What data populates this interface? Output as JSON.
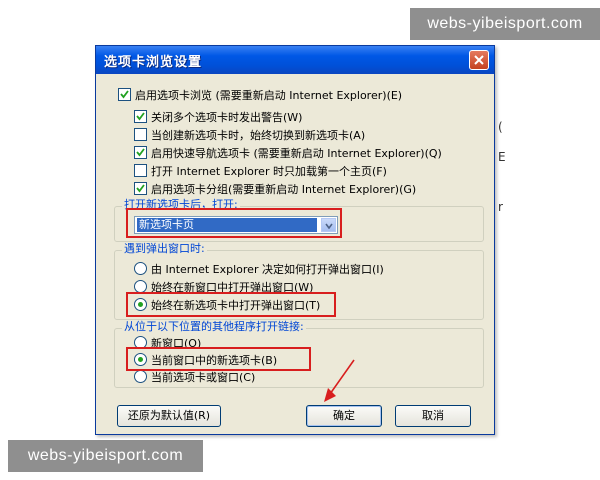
{
  "watermarks": {
    "top": "webs-yibeisport.com",
    "bottom": "webs-yibeisport.com"
  },
  "background": {
    "glyph1": "(",
    "glyph2": "E",
    "glyph3": "r"
  },
  "dialog": {
    "title": "选项卡浏览设置",
    "enable_tabs": {
      "label": "启用选项卡浏览 (需要重新启动 Internet Explorer)",
      "key": "(E)",
      "checked": true
    },
    "options": [
      {
        "label": "关闭多个选项卡时发出警告",
        "key": "(W)",
        "checked": true
      },
      {
        "label": "当创建新选项卡时，始终切换到新选项卡",
        "key": "(A)",
        "checked": false
      },
      {
        "label": "启用快速导航选项卡 (需要重新启动 Internet Explorer)",
        "key": "(Q)",
        "checked": true
      },
      {
        "label": "打开 Internet Explorer 时只加载第一个主页",
        "key": "(F)",
        "checked": false
      },
      {
        "label": "启用选项卡分组(需要重新启动 Internet Explorer)",
        "key": "(G)",
        "checked": true
      }
    ],
    "new_tab_group": {
      "label": "打开新选项卡后，打开:",
      "selected": "新选项卡页"
    },
    "popup_group": {
      "label": "遇到弹出窗口时:",
      "options": [
        {
          "label": "由 Internet Explorer 决定如何打开弹出窗口",
          "key": "(I)",
          "selected": false
        },
        {
          "label": "始终在新窗口中打开弹出窗口",
          "key": "(W)",
          "selected": false
        },
        {
          "label": "始终在新选项卡中打开弹出窗口",
          "key": "(T)",
          "selected": true
        }
      ]
    },
    "links_group": {
      "label": "从位于以下位置的其他程序打开链接:",
      "options": [
        {
          "label": "新窗口",
          "key": "(O)",
          "selected": false
        },
        {
          "label": "当前窗口中的新选项卡",
          "key": "(B)",
          "selected": true
        },
        {
          "label": "当前选项卡或窗口",
          "key": "(C)",
          "selected": false
        }
      ]
    },
    "buttons": {
      "restore": "还原为默认值(R)",
      "ok": "确定",
      "cancel": "取消"
    }
  },
  "colors": {
    "highlight": "#d81e1e",
    "group_label": "#0046d5",
    "title_bar": "#0058e6"
  }
}
